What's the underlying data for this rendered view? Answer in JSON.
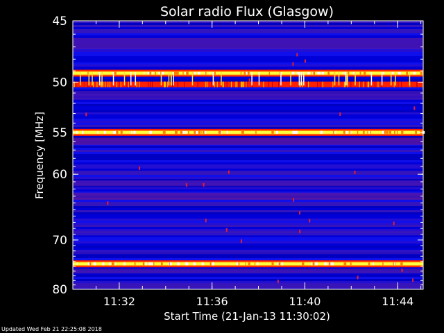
{
  "chart_data": {
    "type": "heatmap",
    "title": "Solar radio Flux (Glasgow)",
    "ylabel": "Frequency [MHz]",
    "xlabel": "Start Time (21-Jan-13 11:30:02)",
    "footer": "Updated Wed Feb 21 22:25:08 2018",
    "x_ticks": [
      "11:32",
      "11:36",
      "11:40",
      "11:44"
    ],
    "x_tick_minutes": [
      2,
      6,
      10,
      14
    ],
    "y_ticks": [
      45,
      50,
      55,
      60,
      70,
      80
    ],
    "ylim": [
      45,
      80
    ],
    "xlim_minutes": [
      0,
      15.1
    ],
    "y_scale": "reciprocal",
    "intense_bands_mhz": [
      {
        "freq": 49.2,
        "level": "high"
      },
      {
        "freq": 50.2,
        "level": "medium"
      },
      {
        "freq": 55.0,
        "level": "high"
      },
      {
        "freq": 74.5,
        "level": "high"
      }
    ],
    "colors": {
      "background": "#000000",
      "low": "#0000d8",
      "mid": "#ff2000",
      "high": "#ffff40"
    }
  }
}
